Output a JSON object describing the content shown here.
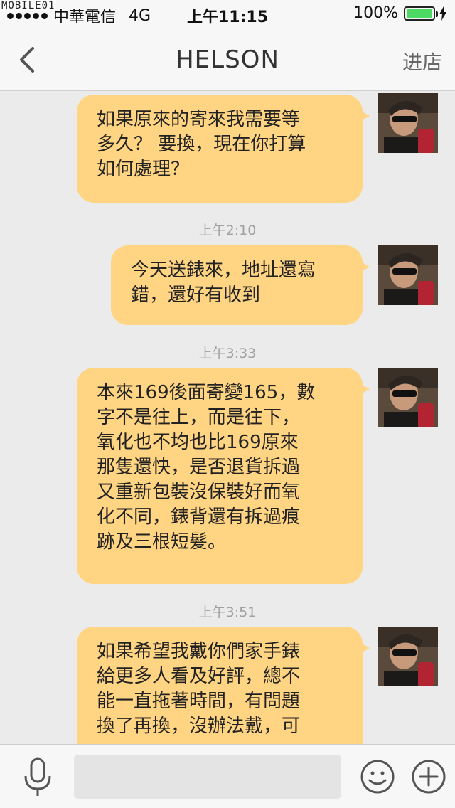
{
  "status_bar": {
    "watermark": "MOBILE01",
    "carrier": "中華電信",
    "network": "4G",
    "time": "上午11:15",
    "battery_percent": "100%",
    "battery_level": 1.0
  },
  "nav": {
    "back_icon": "chevron-left-icon",
    "title": "HELSON",
    "action_label": "进店"
  },
  "messages": [
    {
      "text": "如果原來的寄來我需要等\n多久？ 要換，現在你打算\n如何處理？"
    },
    {
      "timestamp": "上午2:10",
      "text": "今天送錶來，地址還寫\n錯，還好有收到"
    },
    {
      "timestamp": "上午3:33",
      "text": "本來169後面寄變165，數\n字不是往上，而是往下，\n氧化也不均也比169原來\n那隻還快，是否退貨拆過\n又重新包裝沒保裝好而氧\n化不同，錶背還有拆過痕\n跡及三根短髮。"
    },
    {
      "timestamp": "上午3:51",
      "text": "如果希望我戴你們家手錶\n給更多人看及好評，總不\n能一直拖著時間，有問題\n換了再換，沒辦法戴，可"
    }
  ],
  "input_bar": {
    "mic_icon": "microphone-icon",
    "input_value": "",
    "emoji_icon": "smiley-icon",
    "plus_icon": "plus-circle-icon"
  },
  "colors": {
    "bubble": "#ffd482",
    "background": "#ebebeb",
    "bar": "#f7f7f7",
    "battery": "#4cd964"
  }
}
